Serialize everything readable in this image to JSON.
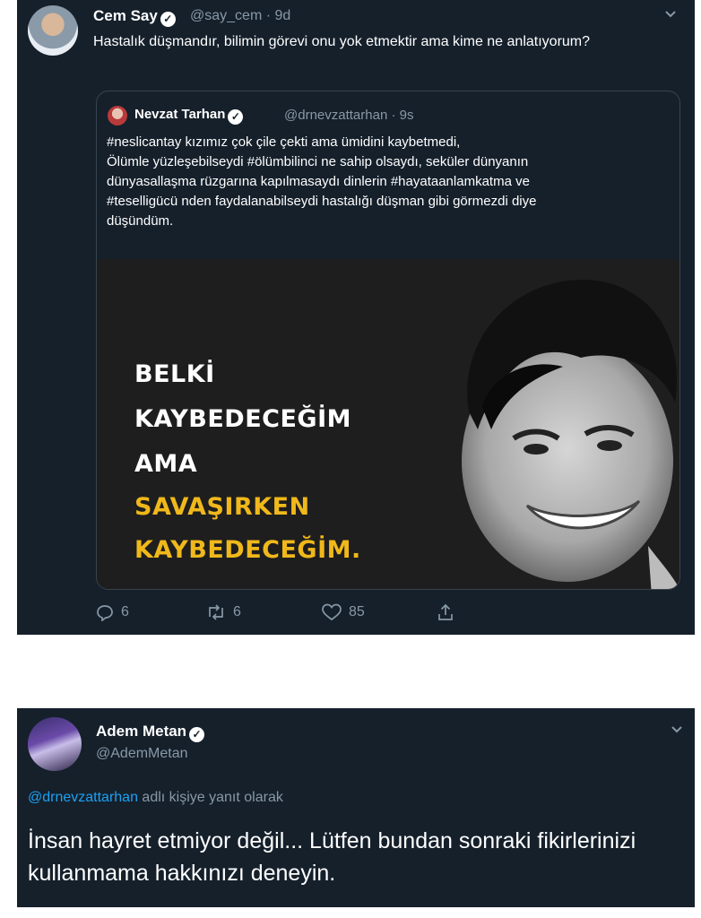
{
  "tweet1": {
    "author_name": "Cem Say",
    "author_handle": "@say_cem",
    "time": "9d",
    "text": "Hastalık düşmandır, bilimin görevi onu yok etmektir ama kime ne anlatıyorum?",
    "quote": {
      "author_name": "Nevzat Tarhan",
      "author_handle": "@drnevzattarhan",
      "time": "9s",
      "text_lines": [
        "#neslicantay kızımız çok çile çekti ama ümidini kaybetmedi,",
        "Ölümle yüzleşebilseydi #ölümbilinci ne sahip olsaydı, seküler dünyanın",
        "dünyasallaşma rüzgarına kapılmasaydı dinlerin #hayataanlamkatma ve",
        "#teselligücü nden faydalanabilseydi hastalığı düşman gibi görmezdi diye",
        "düşündüm."
      ],
      "image_text": {
        "line1": "BELKİ",
        "line2": "KAYBEDECEĞİM",
        "line3": "AMA",
        "line4": "SAVAŞIRKEN",
        "line5": "KAYBEDECEĞİM."
      }
    },
    "actions": {
      "replies": "6",
      "retweets": "6",
      "likes": "85"
    }
  },
  "tweet2": {
    "author_name": "Adem Metan",
    "author_handle": "@AdemMetan",
    "reply_mention": "@drnevzattarhan",
    "reply_suffix": " adlı kişiye yanıt olarak",
    "text": "İnsan hayret etmiyor değil... Lütfen bundan sonraki fikirlerinizi kullanmama hakkınızı deneyin."
  },
  "colors": {
    "card_bg": "#15202b",
    "secondary_text": "#8899a6",
    "link": "#1da1f2",
    "image_highlight": "#f0b81a"
  },
  "icons": [
    "verified-icon",
    "chevron-down-icon",
    "reply-icon",
    "retweet-icon",
    "like-icon",
    "share-icon"
  ]
}
